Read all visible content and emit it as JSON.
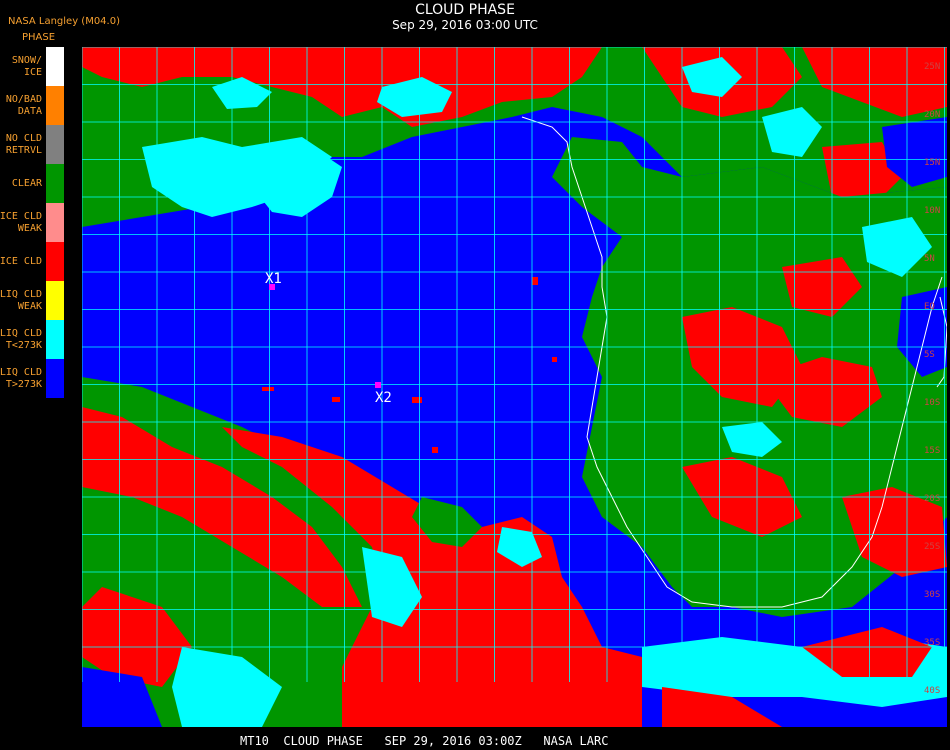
{
  "header": {
    "title": "CLOUD PHASE",
    "subtitle": "Sep 29, 2016 03:00 UTC",
    "provider": "NASA Langley (M04.0)"
  },
  "legend": {
    "title": "PHASE",
    "items": [
      {
        "line1": "SNOW/",
        "line2": "ICE",
        "color": "#ffffff"
      },
      {
        "line1": "NO/BAD",
        "line2": "DATA",
        "color": "#ff8000"
      },
      {
        "line1": "NO CLD",
        "line2": "RETRVL",
        "color": "#808080"
      },
      {
        "line1": "CLEAR",
        "line2": "",
        "color": "#009600"
      },
      {
        "line1": "ICE CLD",
        "line2": "WEAK",
        "color": "#ff8c8c"
      },
      {
        "line1": "ICE CLD",
        "line2": "",
        "color": "#ff0000"
      },
      {
        "line1": "LIQ CLD",
        "line2": "WEAK",
        "color": "#ffff00"
      },
      {
        "line1": "LIQ CLD",
        "line2": "T<273K",
        "color": "#00ffff"
      },
      {
        "line1": "LIQ CLD",
        "line2": "T>273K",
        "color": "#0000ff"
      }
    ]
  },
  "map": {
    "markers": [
      {
        "label": "X1",
        "color": "#ff00ff"
      },
      {
        "label": "X2",
        "color": "#ff00ff"
      }
    ],
    "lat_labels": [
      "25N",
      "20N",
      "15N",
      "10N",
      "5N",
      "EQ",
      "5S",
      "10S",
      "15S",
      "20S",
      "25S",
      "30S",
      "35S",
      "40S"
    ],
    "grid_color": "#00ffff",
    "coast_color": "#ffffff"
  },
  "footer": {
    "text": "MT10  CLOUD PHASE   SEP 29, 2016 03:00Z   NASA LARC"
  }
}
